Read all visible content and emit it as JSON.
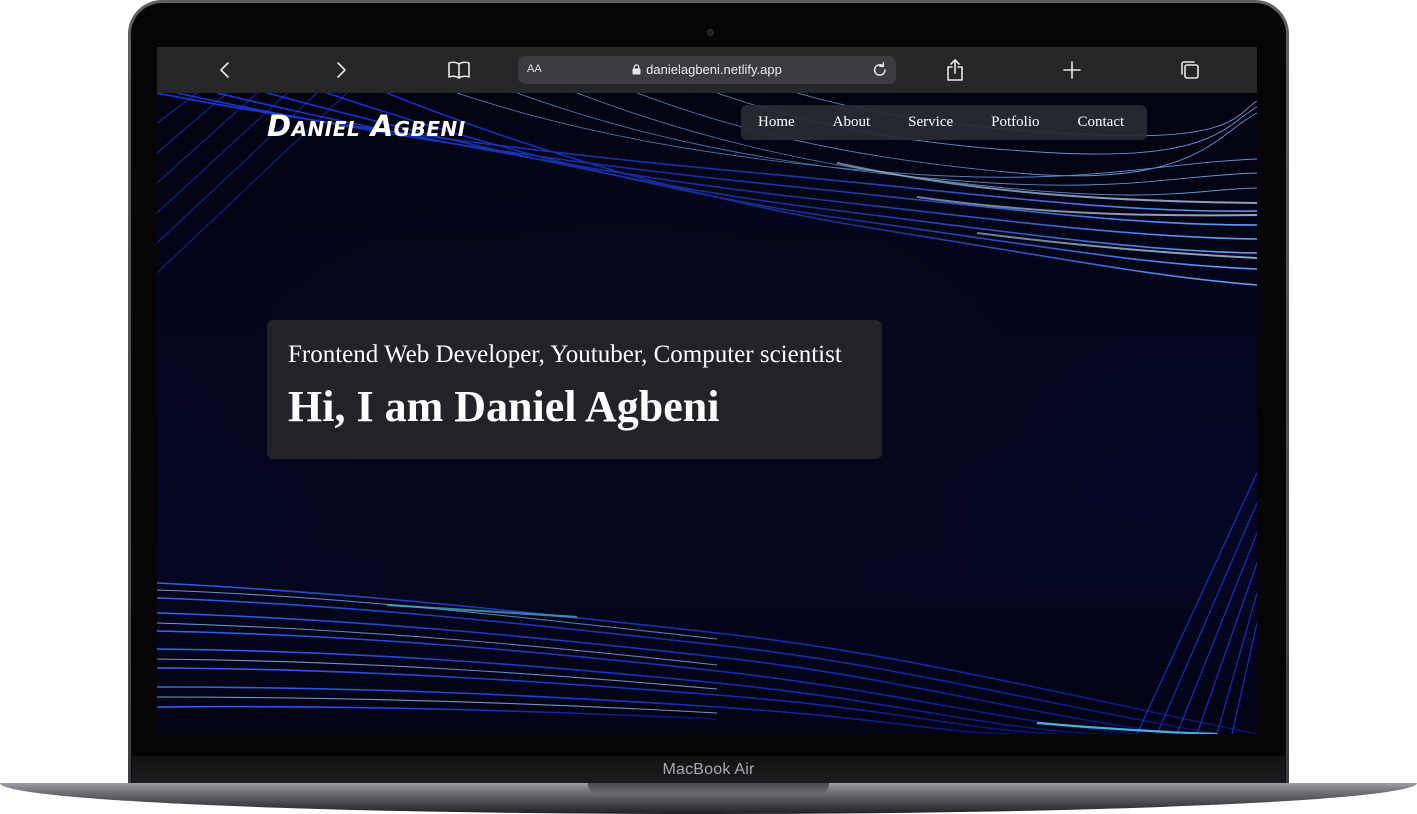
{
  "device": {
    "label": "MacBook Air"
  },
  "browser": {
    "text_size_label": "AA",
    "url": "danielagbeni.netlify.app",
    "icons": [
      "back-icon",
      "forward-icon",
      "bookmarks-icon",
      "lock-icon",
      "reload-icon",
      "share-icon",
      "new-tab-icon",
      "tabs-icon"
    ]
  },
  "site": {
    "logo": "Daniel Agbeni",
    "nav": {
      "home": "Home",
      "about": "About",
      "service": "Service",
      "portfolio": "Potfolio",
      "contact": "Contact"
    },
    "hero": {
      "subtitle": "Frontend Web Developer, Youtuber, Computer scientist",
      "title": "Hi, I am Daniel Agbeni"
    }
  },
  "colors": {
    "accent_blue": "#1a4bff",
    "highlight_cyan": "#5fd8ff",
    "page_background": "#030620",
    "toolbar": "#242628"
  }
}
